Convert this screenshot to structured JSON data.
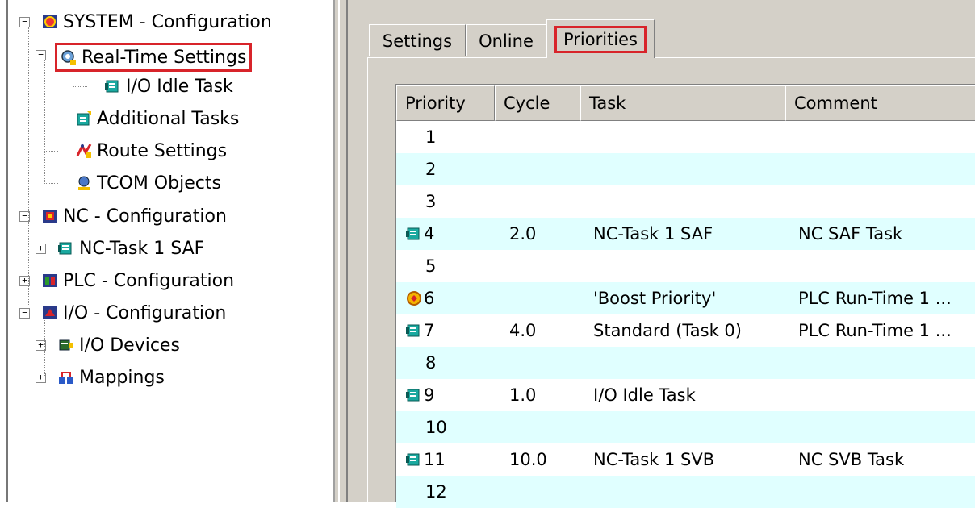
{
  "tree": {
    "items": [
      {
        "label": "SYSTEM - Configuration",
        "icon": "system-config-icon",
        "expander": "−"
      },
      {
        "label": "Real-Time Settings",
        "icon": "realtime-settings-icon",
        "expander": "−"
      },
      {
        "label": "I/O Idle Task",
        "icon": "task-icon",
        "expander": ""
      },
      {
        "label": "Additional Tasks",
        "icon": "additional-tasks-icon",
        "expander": ""
      },
      {
        "label": "Route Settings",
        "icon": "route-settings-icon",
        "expander": ""
      },
      {
        "label": "TCOM Objects",
        "icon": "tcom-objects-icon",
        "expander": ""
      },
      {
        "label": "NC - Configuration",
        "icon": "nc-config-icon",
        "expander": "−"
      },
      {
        "label": "NC-Task 1 SAF",
        "icon": "task-icon",
        "expander": "+"
      },
      {
        "label": "PLC - Configuration",
        "icon": "plc-config-icon",
        "expander": "+"
      },
      {
        "label": "I/O - Configuration",
        "icon": "io-config-icon",
        "expander": "−"
      },
      {
        "label": "I/O Devices",
        "icon": "io-devices-icon",
        "expander": "+"
      },
      {
        "label": "Mappings",
        "icon": "mappings-icon",
        "expander": "+"
      }
    ]
  },
  "tabs": [
    "Settings",
    "Online",
    "Priorities"
  ],
  "active_tab": "Priorities",
  "table": {
    "columns": [
      "Priority",
      "Cycle",
      "Task",
      "Comment"
    ],
    "rows": [
      {
        "priority": "1",
        "cycle": "",
        "task": "",
        "comment": "",
        "icon": ""
      },
      {
        "priority": "2",
        "cycle": "",
        "task": "",
        "comment": "",
        "icon": ""
      },
      {
        "priority": "3",
        "cycle": "",
        "task": "",
        "comment": "",
        "icon": ""
      },
      {
        "priority": "4",
        "cycle": "2.0",
        "task": "NC-Task 1 SAF",
        "comment": "NC SAF Task",
        "icon": "task-icon"
      },
      {
        "priority": "5",
        "cycle": "",
        "task": "",
        "comment": "",
        "icon": ""
      },
      {
        "priority": "6",
        "cycle": "",
        "task": "'Boost Priority'",
        "comment": "PLC Run-Time 1 ...",
        "icon": "boost-priority-icon"
      },
      {
        "priority": "7",
        "cycle": "4.0",
        "task": "Standard (Task 0)",
        "comment": "PLC Run-Time 1 ...",
        "icon": "task-icon"
      },
      {
        "priority": "8",
        "cycle": "",
        "task": "",
        "comment": "",
        "icon": ""
      },
      {
        "priority": "9",
        "cycle": "1.0",
        "task": "I/O Idle Task",
        "comment": "",
        "icon": "task-icon"
      },
      {
        "priority": "10",
        "cycle": "",
        "task": "",
        "comment": "",
        "icon": ""
      },
      {
        "priority": "11",
        "cycle": "10.0",
        "task": "NC-Task 1 SVB",
        "comment": "NC SVB Task",
        "icon": "task-icon"
      },
      {
        "priority": "12",
        "cycle": "",
        "task": "",
        "comment": "",
        "icon": ""
      }
    ]
  },
  "colors": {
    "highlight": "#d8242a",
    "row_alt": "#e0ffff",
    "panel": "#d4d0c8"
  }
}
